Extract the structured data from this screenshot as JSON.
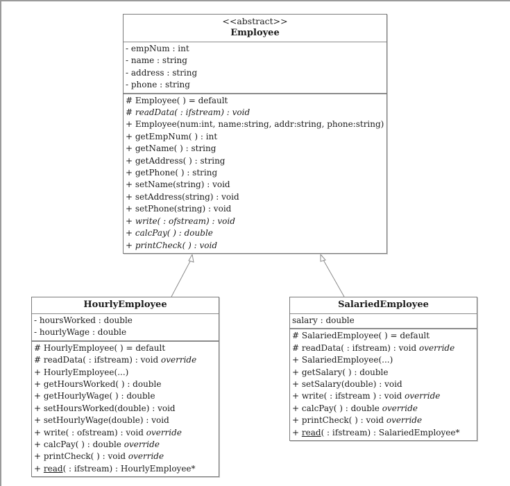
{
  "diagram": {
    "type": "UML class diagram",
    "classes": {
      "employee": {
        "stereotype": "<<abstract>>",
        "name": "Employee",
        "attributes": [
          {
            "text": "- empNum : int"
          },
          {
            "text": "- name : string"
          },
          {
            "text": "- address : string"
          },
          {
            "text": "- phone : string"
          }
        ],
        "operations": [
          {
            "text": "# Employee( ) = default",
            "italic": false
          },
          {
            "text": "# readData( : ifstream) : void",
            "italic": true
          },
          {
            "text": "+ Employee(num:int, name:string, addr:string, phone:string)",
            "italic": false
          },
          {
            "text": "+ getEmpNum( ) : int",
            "italic": false
          },
          {
            "text": "+ getName( ) : string",
            "italic": false
          },
          {
            "text": "+ getAddress( ) : string",
            "italic": false
          },
          {
            "text": "+ getPhone( ) : string",
            "italic": false
          },
          {
            "text": "+ setName(string) : void",
            "italic": false
          },
          {
            "text": "+ setAddress(string) : void",
            "italic": false
          },
          {
            "text": "+ setPhone(string) : void",
            "italic": false
          },
          {
            "text": "+ write( : ofstream) : void",
            "italic": true
          },
          {
            "text": "+ calcPay( ) : double",
            "italic": true
          },
          {
            "text": "+ printCheck( ) : void",
            "italic": true
          }
        ]
      },
      "hourly": {
        "name": "HourlyEmployee",
        "attributes": [
          {
            "text": "- hoursWorked : double"
          },
          {
            "text": "- hourlyWage : double"
          }
        ],
        "operations": [
          {
            "text": "# HourlyEmployee( ) = default"
          },
          {
            "text": "# readData( : ifstream) : void",
            "modifier": "override"
          },
          {
            "text": "+ HourlyEmployee(...)"
          },
          {
            "text": "+ getHoursWorked( ) : double"
          },
          {
            "text": "+ getHourlyWage( ) : double"
          },
          {
            "text": "+ setHoursWorked(double) : void"
          },
          {
            "text": "+ setHourlyWage(double) : void"
          },
          {
            "text": "+ write( : ofstream) : void",
            "modifier": "override"
          },
          {
            "text": "+ calcPay( ) : double",
            "modifier": "override"
          },
          {
            "text": "+ printCheck( ) : void",
            "modifier": "override"
          },
          {
            "prefix": "+ ",
            "underlined": "read",
            "text": "( : ifstream) : HourlyEmployee*"
          }
        ]
      },
      "salaried": {
        "name": "SalariedEmployee",
        "attributes": [
          {
            "text": "salary : double"
          }
        ],
        "operations": [
          {
            "text": "# SalariedEmployee( ) = default"
          },
          {
            "text": "# readData( : ifstream) : void",
            "modifier": "override"
          },
          {
            "text": "+ SalariedEmployee(...)"
          },
          {
            "text": "+ getSalary( ) : double"
          },
          {
            "text": "+ setSalary(double) : void"
          },
          {
            "text": "+ write( : ifstream ) : void",
            "modifier": "override"
          },
          {
            "text": "+ calcPay( ) : double",
            "modifier": "override"
          },
          {
            "text": "+ printCheck( ) : void",
            "modifier": "override"
          },
          {
            "prefix": "+ ",
            "underlined": "read",
            "text": "( : ifstream) : SalariedEmployee*"
          }
        ]
      }
    },
    "relationships": [
      {
        "type": "generalization",
        "from": "HourlyEmployee",
        "to": "Employee"
      },
      {
        "type": "generalization",
        "from": "SalariedEmployee",
        "to": "Employee"
      }
    ],
    "colors": {
      "border": "#7a7a7a",
      "text": "#1a1a1a",
      "frame": "#9a9a9a",
      "background": "#ffffff"
    }
  }
}
